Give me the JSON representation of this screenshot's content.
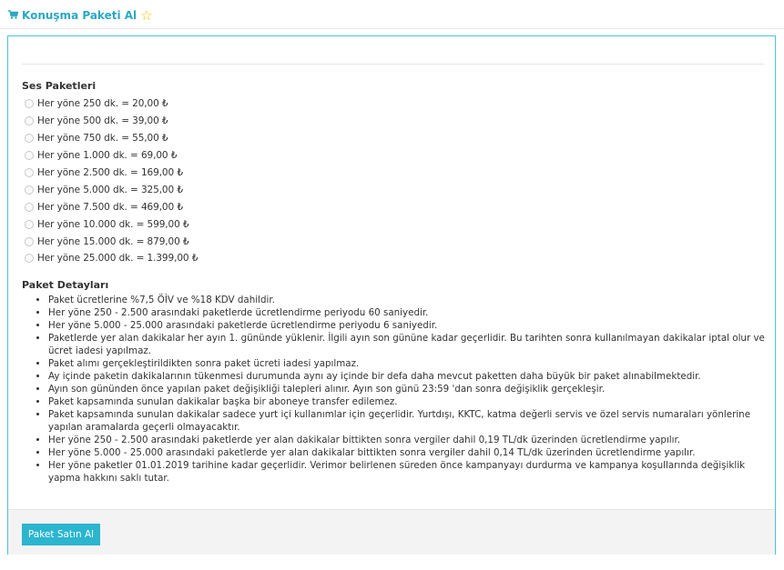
{
  "header": {
    "title": "Konuşma Paketi Al",
    "cart_icon": "cart-icon",
    "star_icon": "star-icon"
  },
  "sections": {
    "packages_title": "Ses Paketleri",
    "details_title": "Paket Detayları"
  },
  "packages": [
    "Her yöne 250 dk. = 20,00 ₺",
    "Her yöne 500 dk. = 39,00 ₺",
    "Her yöne 750 dk. = 55,00 ₺",
    "Her yöne 1.000 dk. = 69,00 ₺",
    "Her yöne 2.500 dk. = 169,00 ₺",
    "Her yöne 5.000 dk. = 325,00 ₺",
    "Her yöne 7.500 dk. = 469,00 ₺",
    "Her yöne 10.000 dk. = 599,00 ₺",
    "Her yöne 15.000 dk. = 879,00 ₺",
    "Her yöne 25.000 dk. = 1.399,00 ₺"
  ],
  "details": [
    "Paket ücretlerine %7,5 ÖİV ve %18 KDV dahildir.",
    "Her yöne 250 - 2.500 arasındaki paketlerde ücretlendirme periyodu 60 saniyedir.",
    "Her yöne 5.000 - 25.000 arasındaki paketlerde ücretlendirme periyodu 6 saniyedir.",
    "Paketlerde yer alan dakikalar her ayın 1. gününde yüklenir. İlgili ayın son gününe kadar geçerlidir. Bu tarihten sonra kullanılmayan dakikalar iptal olur ve ücret iadesi yapılmaz.",
    "Paket alımı gerçekleştirildikten sonra paket ücreti iadesi yapılmaz.",
    "Ay içinde paketin dakikalarının tükenmesi durumunda aynı ay içinde bir defa daha mevcut paketten daha büyük bir paket alınabilmektedir.",
    "Ayın son gününden önce yapılan paket değişikliği talepleri alınır. Ayın son günü 23:59 'dan sonra değişiklik gerçekleşir.",
    "Paket kapsamında sunulan dakikalar başka bir aboneye transfer edilemez.",
    "Paket kapsamında sunulan dakikalar sadece yurt içi kullanımlar için geçerlidir. Yurtdışı, KKTC, katma değerli servis ve özel servis numaraları yönlerine yapılan aramalarda geçerli olmayacaktır.",
    "Her yöne 250 - 2.500 arasındaki paketlerde yer alan dakikalar bittikten sonra vergiler dahil 0,19 TL/dk üzerinden ücretlendirme yapılır.",
    "Her yöne 5.000 - 25.000 arasındaki paketlerde yer alan dakikalar bittikten sonra vergiler dahil 0,14 TL/dk üzerinden ücretlendirme yapılır.",
    "Her yöne paketler 01.01.2019 tarihine kadar geçerlidir. Verimor belirlenen süreden önce kampanyayı durdurma ve kampanya koşullarında değişiklik yapma hakkını saklı tutar."
  ],
  "footer": {
    "buy_label": "Paket Satın Al"
  },
  "colors": {
    "accent": "#2aa8c4",
    "button": "#2bb5cf",
    "star": "#f2c200",
    "panel_border": "#4fc1d6"
  }
}
